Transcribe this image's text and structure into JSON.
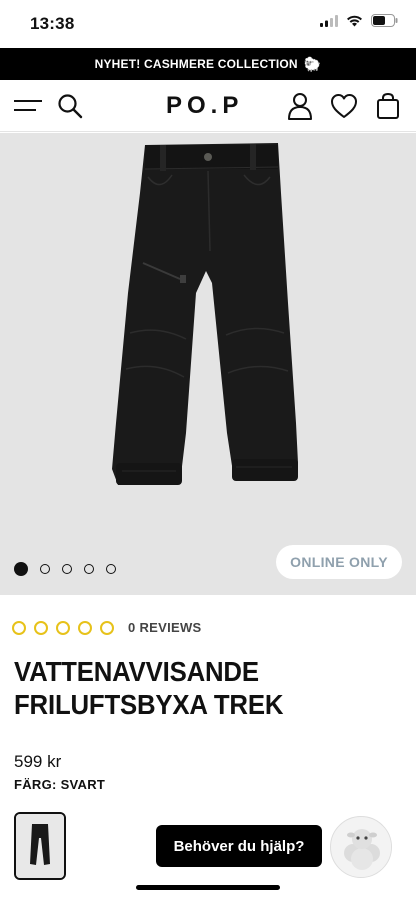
{
  "status_bar": {
    "time": "13:38"
  },
  "promo_banner": {
    "text": "NYHET! CASHMERE COLLECTION",
    "icon": "sheep-icon",
    "glyph": "🐑"
  },
  "header": {
    "logo": "PO.P",
    "icons": [
      "menu-icon",
      "search-icon",
      "account-icon",
      "wishlist-heart-icon",
      "shopping-bag-icon"
    ]
  },
  "gallery": {
    "total_images": 5,
    "active_index": 0,
    "badge": "ONLINE ONLY"
  },
  "product": {
    "rating": {
      "stars_filled": 0,
      "stars_total": 5,
      "reviews_label": "0 REVIEWS"
    },
    "title": "VATTENAVVISANDE FRILUFTSBYXA TREK",
    "price": "599 kr",
    "color_label": "FÄRG: SVART"
  },
  "chat": {
    "button_label": "Behöver du hjälp?"
  },
  "colors": {
    "accent_star": "#e7c21a",
    "badge_text": "#8fa0ad",
    "hero_bg": "#e4e4e4",
    "banner_bg": "#000000"
  }
}
